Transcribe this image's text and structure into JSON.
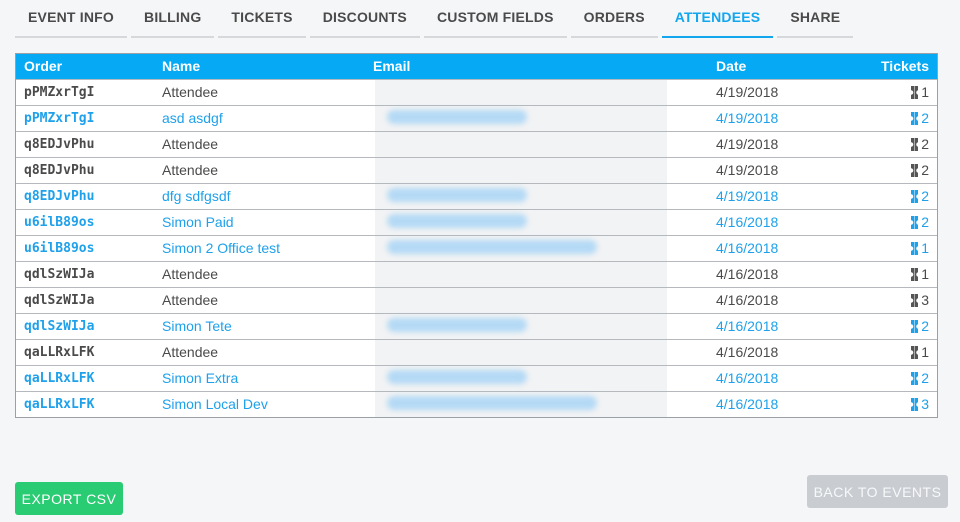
{
  "tabs": [
    {
      "label": "EVENT INFO",
      "active": false
    },
    {
      "label": "BILLING",
      "active": false
    },
    {
      "label": "TICKETS",
      "active": false
    },
    {
      "label": "DISCOUNTS",
      "active": false
    },
    {
      "label": "CUSTOM FIELDS",
      "active": false
    },
    {
      "label": "ORDERS",
      "active": false
    },
    {
      "label": "ATTENDEES",
      "active": true
    },
    {
      "label": "SHARE",
      "active": false
    }
  ],
  "table": {
    "headers": {
      "order": "Order",
      "name": "Name",
      "email": "Email",
      "date": "Date",
      "tickets": "Tickets"
    },
    "rows": [
      {
        "order": "pPMZxrTgI",
        "name": "Attendee",
        "date": "4/19/2018",
        "tickets": "1",
        "paid": false,
        "email_blurred": false
      },
      {
        "order": "pPMZxrTgI",
        "name": "asd asdgf",
        "date": "4/19/2018",
        "tickets": "2",
        "paid": true,
        "email_blurred": true
      },
      {
        "order": "q8EDJvPhu",
        "name": "Attendee",
        "date": "4/19/2018",
        "tickets": "2",
        "paid": false,
        "email_blurred": false
      },
      {
        "order": "q8EDJvPhu",
        "name": "Attendee",
        "date": "4/19/2018",
        "tickets": "2",
        "paid": false,
        "email_blurred": false
      },
      {
        "order": "q8EDJvPhu",
        "name": "dfg sdfgsdf",
        "date": "4/19/2018",
        "tickets": "2",
        "paid": true,
        "email_blurred": true
      },
      {
        "order": "u6ilB89os",
        "name": "Simon Paid",
        "date": "4/16/2018",
        "tickets": "2",
        "paid": true,
        "email_blurred": true
      },
      {
        "order": "u6ilB89os",
        "name": "Simon 2 Office test",
        "date": "4/16/2018",
        "tickets": "1",
        "paid": true,
        "email_blurred": true
      },
      {
        "order": "qdlSzWIJa",
        "name": "Attendee",
        "date": "4/16/2018",
        "tickets": "1",
        "paid": false,
        "email_blurred": false
      },
      {
        "order": "qdlSzWIJa",
        "name": "Attendee",
        "date": "4/16/2018",
        "tickets": "3",
        "paid": false,
        "email_blurred": false
      },
      {
        "order": "qdlSzWIJa",
        "name": "Simon Tete",
        "date": "4/16/2018",
        "tickets": "2",
        "paid": true,
        "email_blurred": true
      },
      {
        "order": "qaLLRxLFK",
        "name": "Attendee",
        "date": "4/16/2018",
        "tickets": "1",
        "paid": false,
        "email_blurred": false
      },
      {
        "order": "qaLLRxLFK",
        "name": "Simon Extra",
        "date": "4/16/2018",
        "tickets": "2",
        "paid": true,
        "email_blurred": true
      },
      {
        "order": "qaLLRxLFK",
        "name": "Simon Local Dev",
        "date": "4/16/2018",
        "tickets": "3",
        "paid": true,
        "email_blurred": true
      }
    ]
  },
  "buttons": {
    "export": "EXPORT CSV",
    "back": "BACK TO EVENTS"
  },
  "colors": {
    "accent": "#06a9f4",
    "paid_text": "#1ea1ea",
    "export_bg": "#29cc72",
    "back_bg": "#c9cdd2"
  },
  "icons": {
    "ticket": "ticket-icon"
  }
}
